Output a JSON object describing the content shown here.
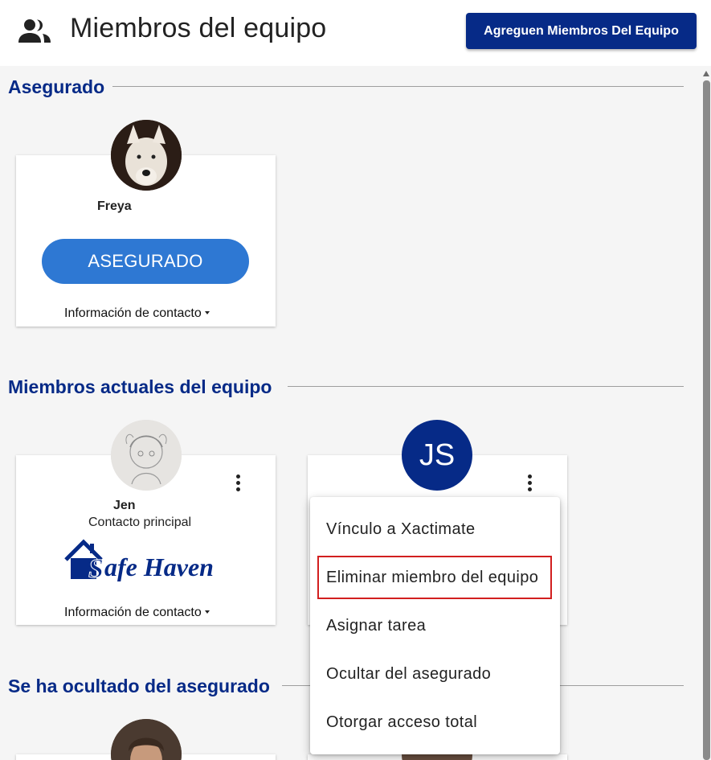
{
  "header": {
    "title": "Miembros del equipo",
    "add_button": "Agreguen Miembros Del Equipo",
    "icon": "team-icon"
  },
  "sections": {
    "insured": {
      "title": "Asegurado"
    },
    "current": {
      "title": "Miembros actuales del equipo"
    },
    "hidden": {
      "title": "Se ha ocultado del asegurado"
    }
  },
  "insured_card": {
    "name": "Freya",
    "status_button": "ASEGURADO",
    "contact_toggle": "Información de contacto"
  },
  "current_members": [
    {
      "name": "Jen",
      "role": "Contacto principal",
      "company_logo": "Safe Haven",
      "contact_toggle": "Información de contacto"
    },
    {
      "initials": "JS"
    }
  ],
  "context_menu": {
    "items": [
      "Vínculo a Xactimate",
      "Eliminar miembro del equipo",
      "Asignar tarea",
      "Ocultar del asegurado",
      "Otorgar acceso total"
    ],
    "highlighted_index": 1
  },
  "colors": {
    "brand_navy": "#062a87",
    "insured_button": "#2e78d3",
    "highlight": "#d21f1f"
  }
}
